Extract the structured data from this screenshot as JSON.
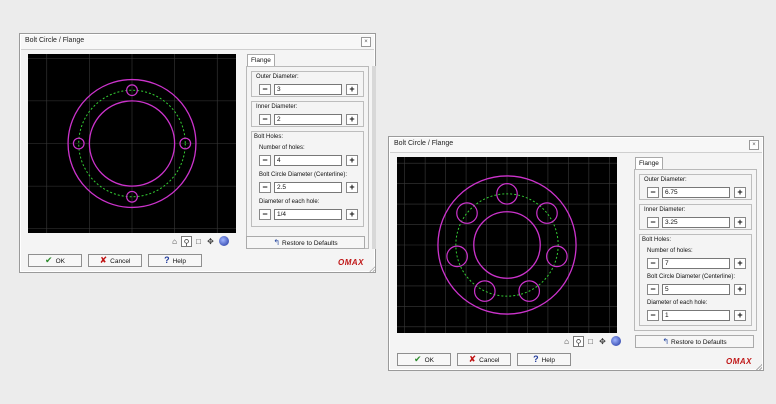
{
  "dialogs": [
    {
      "title": "Bolt Circle / Flange",
      "close_glyph": "×",
      "tab": "Flange",
      "outer_label": "Outer Diameter:",
      "outer_value": "3",
      "inner_label": "Inner Diameter:",
      "inner_value": "2",
      "bolt_group_label": "Bolt Holes:",
      "holes_label": "Number of holes:",
      "holes_value": "4",
      "bcd_label": "Bolt Circle Diameter (Centerline):",
      "bcd_value": "2.5",
      "hole_dia_label": "Diameter of each hole:",
      "hole_dia_value": "1/4",
      "minus": "−",
      "plus": "+",
      "restore": "Restore to Defaults",
      "ok": "OK",
      "cancel": "Cancel",
      "help": "Help",
      "logo": "OMAX",
      "preview": {
        "outer": 3,
        "inner": 2,
        "holes": 4,
        "bcd": 2.5,
        "hole_dia": 0.25,
        "view_span": 4.2
      }
    },
    {
      "title": "Bolt Circle / Flange",
      "close_glyph": "×",
      "tab": "Flange",
      "outer_label": "Outer Diameter:",
      "outer_value": "6.75",
      "inner_label": "Inner Diameter:",
      "inner_value": "3.25",
      "bolt_group_label": "Bolt Holes:",
      "holes_label": "Number of holes:",
      "holes_value": "7",
      "bcd_label": "Bolt Circle Diameter (Centerline):",
      "bcd_value": "5",
      "hole_dia_label": "Diameter of each hole:",
      "hole_dia_value": "1",
      "minus": "−",
      "plus": "+",
      "restore": "Restore to Defaults",
      "ok": "OK",
      "cancel": "Cancel",
      "help": "Help",
      "logo": "OMAX",
      "preview": {
        "outer": 6.75,
        "inner": 3.25,
        "holes": 7,
        "bcd": 5,
        "hole_dia": 1,
        "view_span": 8.6
      }
    }
  ],
  "colors": {
    "shape": "#cc33cc",
    "centerline": "#33cc33",
    "grid": "#3a3a3a"
  },
  "tool_icons": [
    "select-icon",
    "zoom-icon",
    "zoom-box-icon",
    "pan-icon",
    "globe-icon"
  ]
}
